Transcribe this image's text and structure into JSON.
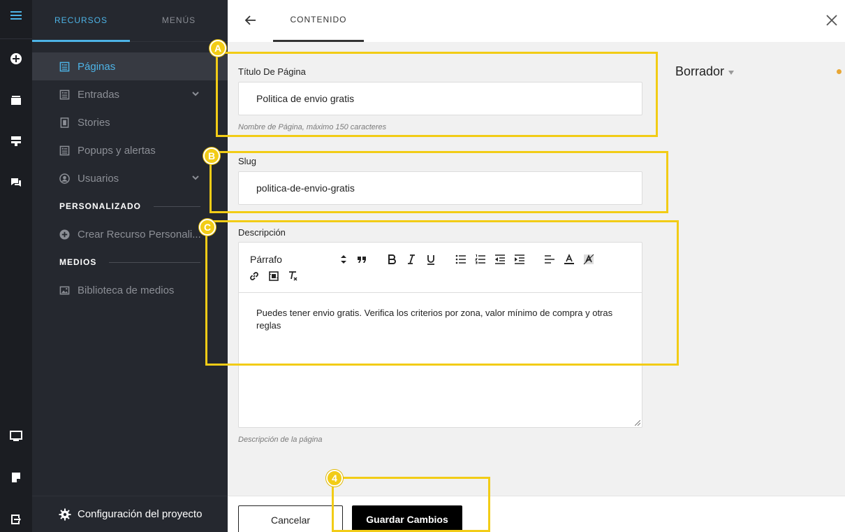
{
  "rail": {
    "icons": [
      "menu-icon",
      "add-circle-icon",
      "folder-icon",
      "layout-icon",
      "chat-icon",
      "monitor-icon",
      "note-icon",
      "logout-icon"
    ]
  },
  "sidebar": {
    "tabs": [
      {
        "label": "RECURSOS"
      },
      {
        "label": "MENÚS"
      }
    ],
    "items": [
      {
        "label": "Páginas"
      },
      {
        "label": "Entradas"
      },
      {
        "label": "Stories"
      },
      {
        "label": "Popups y alertas"
      },
      {
        "label": "Usuarios"
      }
    ],
    "sections": {
      "custom": "PERSONALIZADO",
      "media": "MEDIOS"
    },
    "custom_item": "Crear Recurso Personali...",
    "media_item": "Biblioteca de medios",
    "footer": "Configuración del proyecto"
  },
  "header": {
    "tab": "CONTENIDO"
  },
  "form": {
    "title_label": "Título De Página",
    "title_value": "Politica de envio gratis",
    "title_hint": "Nombre de Página, máximo 150 caracteres",
    "slug_label": "Slug",
    "slug_value": "politica-de-envio-gratis",
    "desc_label": "Descripción",
    "desc_format": "Párrafo",
    "desc_value": "Puedes tener envio gratis. Verifica los criterios por zona, valor mínimo de compra y otras reglas",
    "desc_hint": "Descripción de la página"
  },
  "status": {
    "label": "Borrador",
    "dot_color": "#e8a735"
  },
  "footer": {
    "cancel": "Cancelar",
    "save": "Guardar Cambios"
  },
  "annotations": {
    "a": "A",
    "b": "B",
    "c": "C",
    "d": "4"
  },
  "colors": {
    "accent": "#4db3e6",
    "highlight": "#f2cc16"
  }
}
